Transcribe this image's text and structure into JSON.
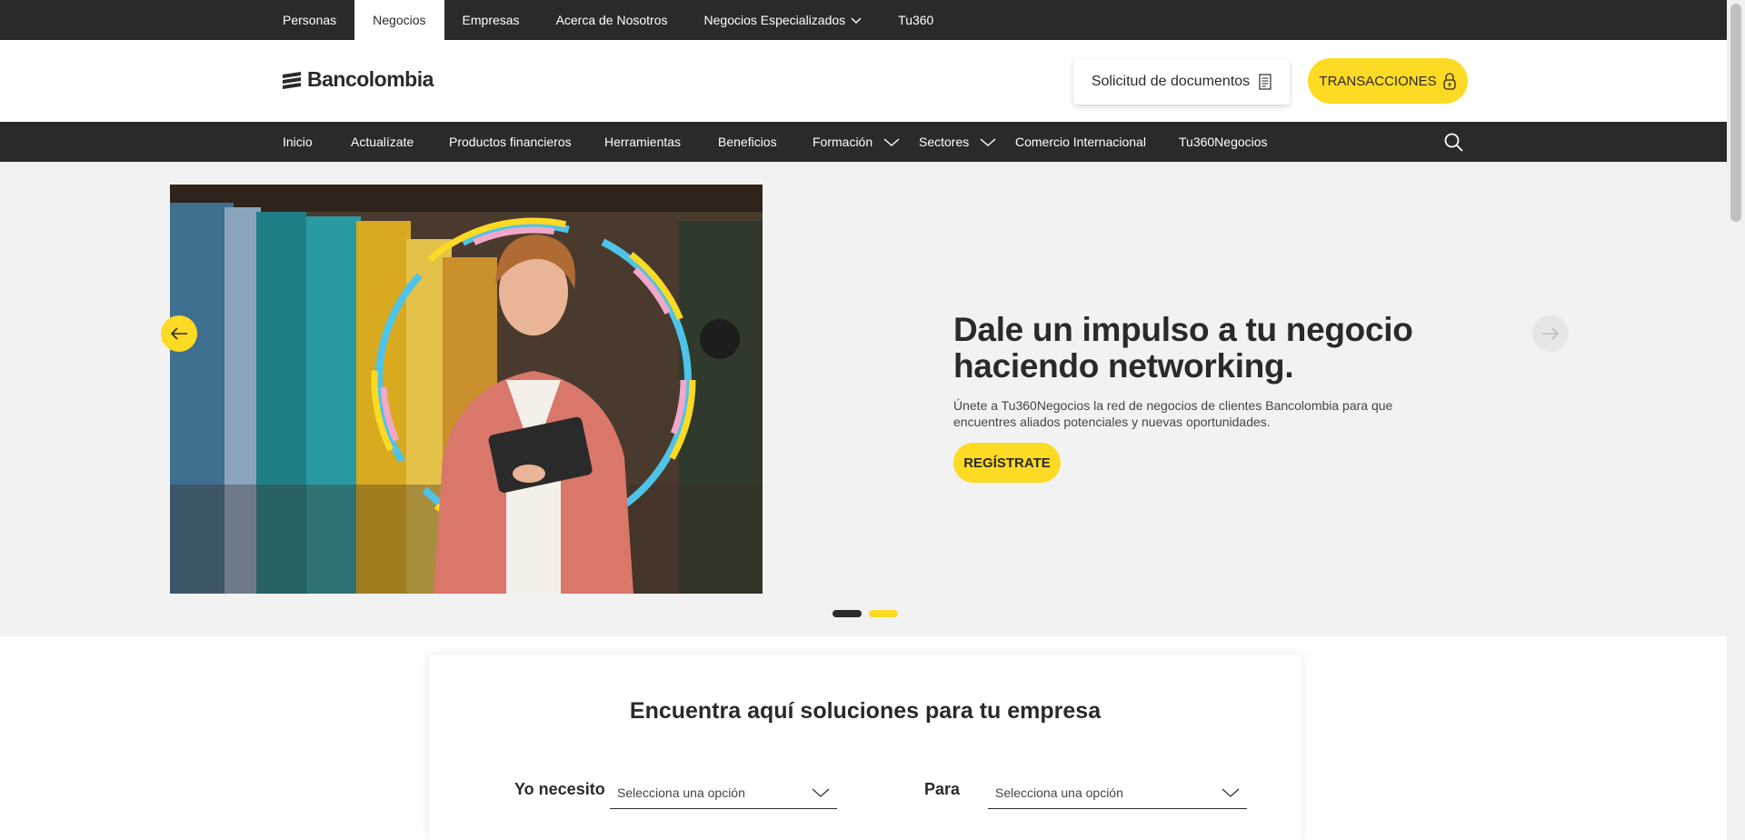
{
  "segments": [
    {
      "label": "Personas",
      "active": false
    },
    {
      "label": "Negocios",
      "active": true
    },
    {
      "label": "Empresas",
      "active": false
    },
    {
      "label": "Acerca de Nosotros",
      "active": false
    },
    {
      "label": "Negocios Especializados",
      "active": false
    },
    {
      "label": "Tu360",
      "active": false
    }
  ],
  "header": {
    "logo_text": "Bancolombia",
    "docs_label": "Solicitud de documentos",
    "transactions_label": "TRANSACCIONES"
  },
  "nav": {
    "items": [
      "Inicio",
      "Actualízate",
      "Productos financieros",
      "Herramientas",
      "Beneficios",
      "Formación",
      "Sectores",
      "Comercio Internacional",
      "Tu360Negocios"
    ]
  },
  "hero": {
    "title_line1": "Dale un impulso a tu negocio",
    "title_line2": "haciendo networking.",
    "description": "Únete a Tu360Negocios la red de negocios de clientes Bancolombia para que encuentres aliados potenciales y nuevas oportunidades.",
    "cta_label": "REGÍSTRATE",
    "slides_total": 2,
    "active_slide": 1
  },
  "solutions": {
    "title": "Encuentra aquí soluciones para tu empresa",
    "need_label": "Yo necesito",
    "need_placeholder": "Selecciona una opción",
    "for_label": "Para",
    "for_placeholder": "Selecciona una opción"
  },
  "colors": {
    "brand_yellow": "#fdda24",
    "dark": "#2c2a29",
    "hero_bg": "#f2f2f2"
  }
}
